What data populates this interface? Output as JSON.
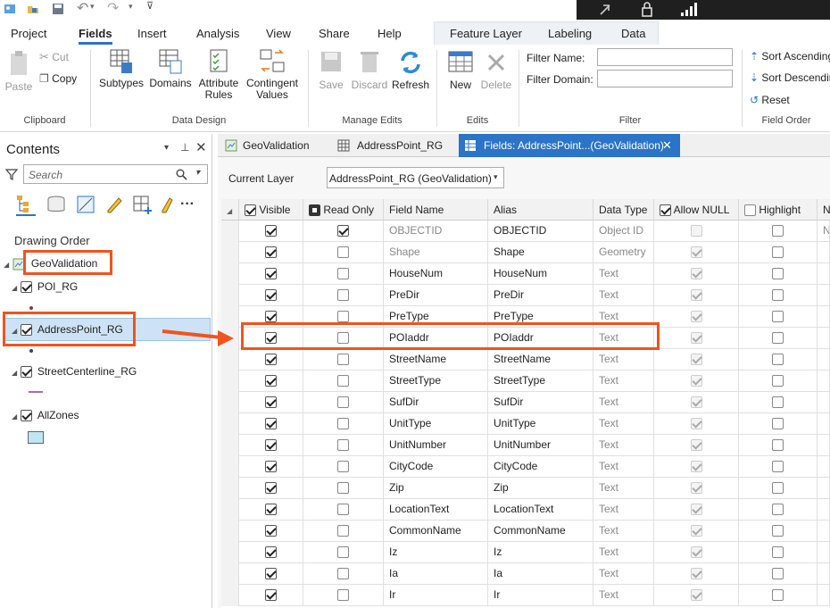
{
  "ribbon_tabs": [
    "Project",
    "Fields",
    "Insert",
    "Analysis",
    "View",
    "Share",
    "Help"
  ],
  "context_tabs": [
    "Feature Layer",
    "Labeling",
    "Data"
  ],
  "ribbon": {
    "clipboard": {
      "paste": "Paste",
      "cut": "Cut",
      "copy": "Copy",
      "group": "Clipboard"
    },
    "data_design": {
      "subtypes": "Subtypes",
      "domains": "Domains",
      "attribute_rules": [
        "Attribute",
        "Rules"
      ],
      "contingent_values": [
        "Contingent",
        "Values"
      ],
      "group": "Data Design"
    },
    "manage_edits": {
      "save": "Save",
      "discard": "Discard",
      "refresh": "Refresh",
      "group": "Manage Edits"
    },
    "edits": {
      "new": "New",
      "delete": "Delete",
      "group": "Edits"
    },
    "filter": {
      "name_label": "Filter Name:",
      "domain_label": "Filter Domain:",
      "group": "Filter"
    },
    "field_order": {
      "sort_asc": "Sort Ascending",
      "sort_desc": "Sort Descending",
      "reset": "Reset",
      "group": "Field Order"
    }
  },
  "contents": {
    "title": "Contents",
    "search_placeholder": "Search",
    "drawing_order": "Drawing Order",
    "map": "GeoValidation",
    "layers": [
      "POI_RG",
      "AddressPoint_RG",
      "StreetCenterline_RG",
      "AllZones"
    ]
  },
  "view_tabs": [
    "GeoValidation",
    "AddressPoint_RG",
    "Fields: AddressPoint...(GeoValidation)"
  ],
  "current_layer_label": "Current Layer",
  "current_layer_value": "AddressPoint_RG (GeoValidation)",
  "grid": {
    "headers": [
      "Visible",
      "Read Only",
      "Field Name",
      "Alias",
      "Data Type",
      "Allow NULL",
      "Highlight",
      "N"
    ],
    "rows": [
      {
        "field": "OBJECTID",
        "alias": "OBJECTID",
        "type": "Object ID",
        "readonly": true,
        "allownull": false,
        "extra": "No"
      },
      {
        "field": "Shape",
        "alias": "Shape",
        "type": "Geometry",
        "readonly": false,
        "allownull": true,
        "extra": ""
      },
      {
        "field": "HouseNum",
        "alias": "HouseNum",
        "type": "Text",
        "readonly": false,
        "allownull": true,
        "extra": ""
      },
      {
        "field": "PreDir",
        "alias": "PreDir",
        "type": "Text",
        "readonly": false,
        "allownull": true,
        "extra": ""
      },
      {
        "field": "PreType",
        "alias": "PreType",
        "type": "Text",
        "readonly": false,
        "allownull": true,
        "extra": ""
      },
      {
        "field": "POIaddr",
        "alias": "POIaddr",
        "type": "Text",
        "readonly": false,
        "allownull": true,
        "extra": ""
      },
      {
        "field": "StreetName",
        "alias": "StreetName",
        "type": "Text",
        "readonly": false,
        "allownull": true,
        "extra": ""
      },
      {
        "field": "StreetType",
        "alias": "StreetType",
        "type": "Text",
        "readonly": false,
        "allownull": true,
        "extra": ""
      },
      {
        "field": "SufDir",
        "alias": "SufDir",
        "type": "Text",
        "readonly": false,
        "allownull": true,
        "extra": ""
      },
      {
        "field": "UnitType",
        "alias": "UnitType",
        "type": "Text",
        "readonly": false,
        "allownull": true,
        "extra": ""
      },
      {
        "field": "UnitNumber",
        "alias": "UnitNumber",
        "type": "Text",
        "readonly": false,
        "allownull": true,
        "extra": ""
      },
      {
        "field": "CityCode",
        "alias": "CityCode",
        "type": "Text",
        "readonly": false,
        "allownull": true,
        "extra": ""
      },
      {
        "field": "Zip",
        "alias": "Zip",
        "type": "Text",
        "readonly": false,
        "allownull": true,
        "extra": ""
      },
      {
        "field": "LocationText",
        "alias": "LocationText",
        "type": "Text",
        "readonly": false,
        "allownull": true,
        "extra": ""
      },
      {
        "field": "CommonName",
        "alias": "CommonName",
        "type": "Text",
        "readonly": false,
        "allownull": true,
        "extra": ""
      },
      {
        "field": "Iz",
        "alias": "Iz",
        "type": "Text",
        "readonly": false,
        "allownull": true,
        "extra": ""
      },
      {
        "field": "Ia",
        "alias": "Ia",
        "type": "Text",
        "readonly": false,
        "allownull": true,
        "extra": ""
      },
      {
        "field": "Ir",
        "alias": "Ir",
        "type": "Text",
        "readonly": false,
        "allownull": true,
        "extra": ""
      }
    ]
  },
  "colors": {
    "highlight": "#f0541f",
    "accent": "#2b74c7"
  }
}
